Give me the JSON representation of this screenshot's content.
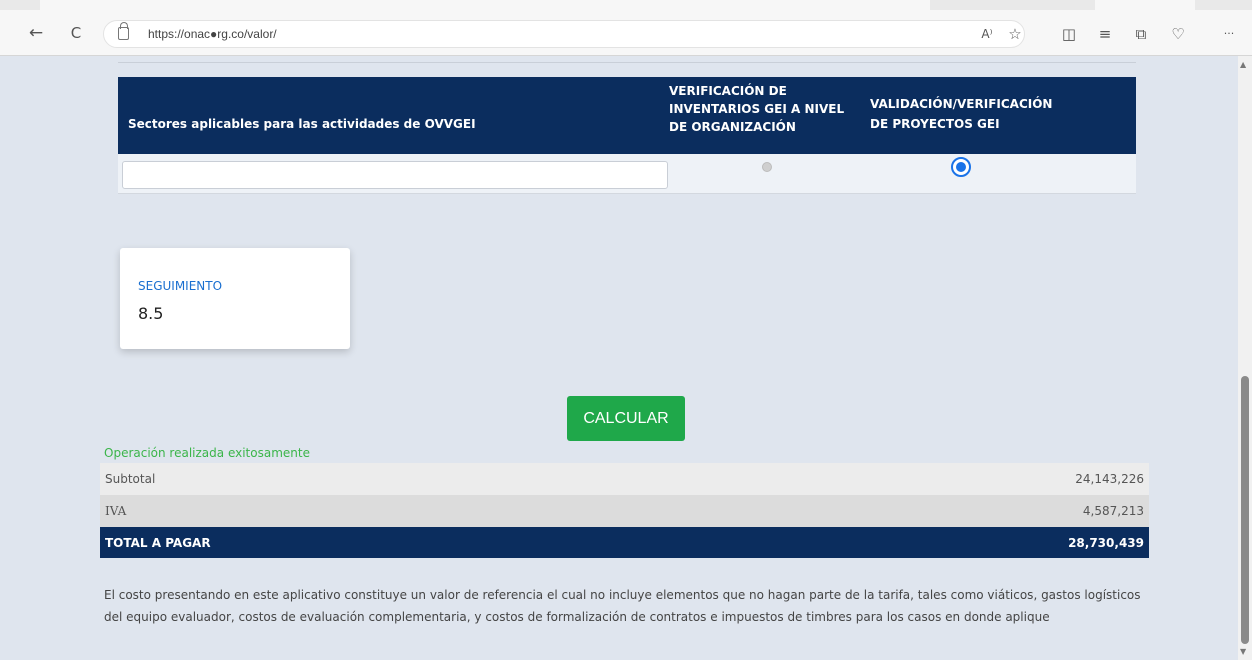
{
  "browser": {
    "url": "https://onac●rg.co/valor/",
    "icons": [
      "back-icon",
      "refresh-icon",
      "lock-icon",
      "read-aloud-icon",
      "favorite-icon",
      "split-screen-icon",
      "favorites-list-icon",
      "collections-icon",
      "browser-essentials-icon",
      "more-icon"
    ],
    "back_glyph": "←",
    "refresh_glyph": "C",
    "read_aloud_glyph": "A⁾",
    "favorite_glyph": "☆",
    "split_glyph": "◫",
    "favorites_list_glyph": "≡",
    "collections_glyph": "⧉",
    "essentials_glyph": "♡",
    "more_glyph": "···"
  },
  "sectors_table": {
    "header_sectors": "Sectores aplicables para las actividades de OVVGEI",
    "header_col2": "VERIFICACIÓN DE INVENTARIOS GEI A NIVEL DE ORGANIZACIÓN",
    "header_col3": "VALIDACIÓN/VERIFICACIÓN DE PROYECTOS GEI",
    "sector_value": "",
    "col2_selected": false,
    "col3_selected": true
  },
  "seguimiento_card": {
    "label": "SEGUIMIENTO",
    "value": "8.5"
  },
  "calculate_button": "CALCULAR",
  "success_message": "Operación realizada exitosamente",
  "totals": {
    "subtotal_label": "Subtotal",
    "subtotal_value": "24,143,226",
    "iva_label": "IVA",
    "iva_value": "4,587,213",
    "total_label": "TOTAL A PAGAR",
    "total_value": "28,730,439"
  },
  "disclaimer": "El costo presentando en este aplicativo constituye un valor de referencia el cual no incluye elementos que no hagan parte de la tarifa, tales como viáticos, gastos logísticos del equipo evaluador, costos de evaluación complementaria, y costos de formalización de contratos e impuestos de timbres para los casos en donde aplique",
  "colors": {
    "header_navy": "#0b2d5e",
    "button_green": "#1fa84a",
    "success_green": "#3bb54a",
    "label_blue": "#1a6fd0",
    "radio_blue": "#1a73e8"
  }
}
